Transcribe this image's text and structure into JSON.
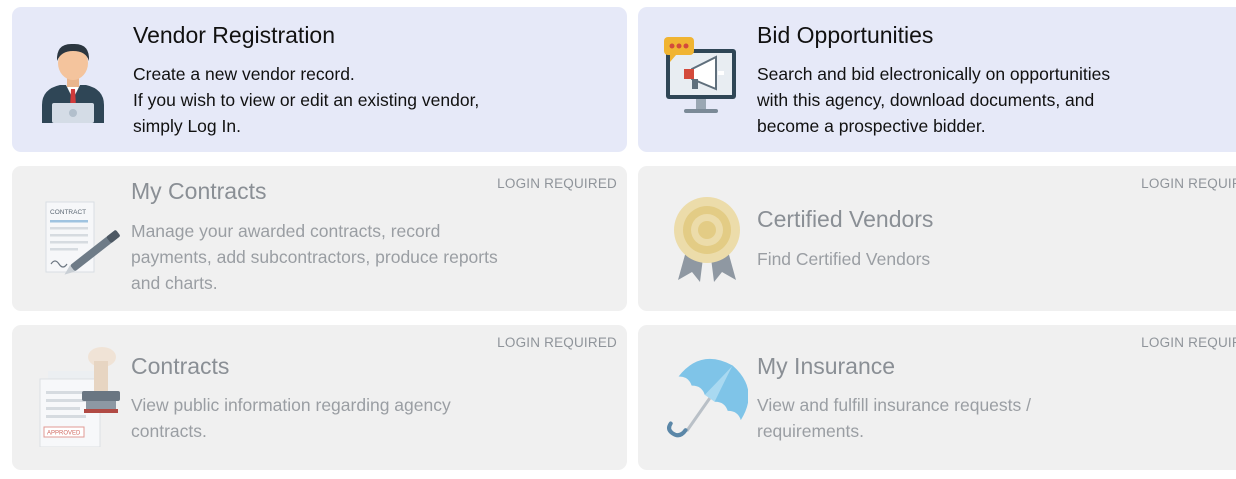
{
  "cards": [
    {
      "title": "Vendor Registration",
      "lines": [
        "Create a new vendor record.",
        "If you wish to view or edit an existing vendor,",
        "simply Log In."
      ],
      "icon": "vendor-person-icon"
    },
    {
      "title": "Bid Opportunities",
      "lines": [
        "Search and bid electronically on opportunities",
        "with this agency, download documents, and",
        "become a prospective bidder."
      ],
      "icon": "megaphone-monitor-icon"
    },
    {
      "title": "My Contracts",
      "lines": [
        "Manage your awarded contracts, record",
        "payments, add subcontractors, produce reports",
        "and charts."
      ],
      "badge": "LOGIN REQUIRED",
      "icon": "contract-pen-icon",
      "icon_text": "CONTRACT"
    },
    {
      "title": "Certified Vendors",
      "lines": [
        "Find Certified Vendors"
      ],
      "badge": "LOGIN REQUIRED",
      "icon": "award-seal-icon"
    },
    {
      "title": "Contracts",
      "lines": [
        "View public information regarding agency",
        "contracts."
      ],
      "badge": "LOGIN REQUIRED",
      "icon": "approved-stamp-icon",
      "icon_text": "APPROVED"
    },
    {
      "title": "My Insurance",
      "lines": [
        "View and fulfill insurance requests /",
        "requirements."
      ],
      "badge": "LOGIN REQUIRED",
      "icon": "umbrella-icon"
    }
  ]
}
